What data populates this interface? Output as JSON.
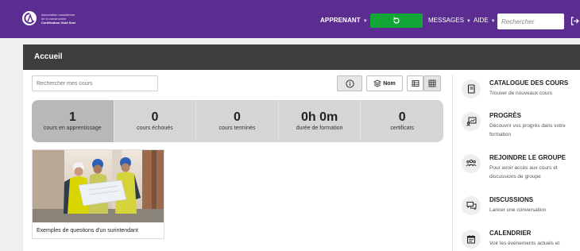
{
  "topbar": {
    "brand_lines": [
      "Association canadienne",
      "de la construction",
      "Certification Gold Seal"
    ],
    "learner_label": "APPRENANT",
    "messages_label": "MESSAGES",
    "help_label": "AIDE",
    "search_placeholder": "Rechercher",
    "accent_color": "#5c2d91",
    "refresh_button_color": "#13a535"
  },
  "panel": {
    "title": "Accueil",
    "course_search_placeholder": "Rechercher mes cours",
    "sort_label": "Nom"
  },
  "stats": [
    {
      "value": "1",
      "label": "cours en apprentissage"
    },
    {
      "value": "0",
      "label": "cours échoués"
    },
    {
      "value": "0",
      "label": "cours terminés"
    },
    {
      "value": "0h 0m",
      "label": "durée de formation"
    },
    {
      "value": "0",
      "label": "certificats"
    }
  ],
  "courses": [
    {
      "title": "Exemples de questions d'un surintendant"
    }
  ],
  "sidebar": [
    {
      "title": "CATALOGUE DES COURS",
      "desc": "Trouver de nouveaux cours",
      "icon": "book-icon"
    },
    {
      "title": "PROGRÈS",
      "desc": "Découvrir vos progrès dans votre formation",
      "icon": "progress-chart-icon"
    },
    {
      "title": "REJOINDRE LE GROUPE",
      "desc": "Pour avoir accès aux cours et discussions de groupe",
      "icon": "group-icon"
    },
    {
      "title": "DISCUSSIONS",
      "desc": "Lancer une conversation",
      "icon": "chat-icon"
    },
    {
      "title": "CALENDRIER",
      "desc": "Voir les événements actuels et",
      "icon": "calendar-icon"
    }
  ]
}
